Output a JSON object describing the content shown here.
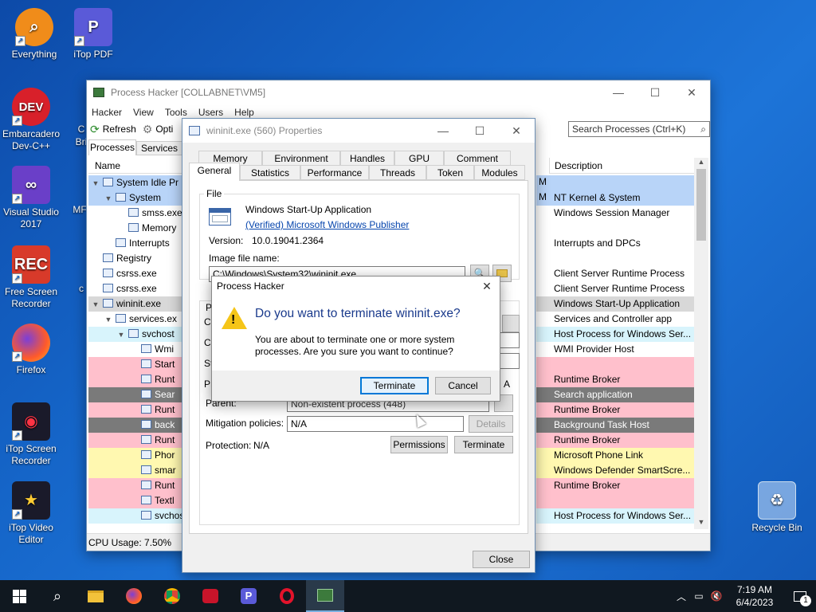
{
  "desktop": {
    "icons": [
      {
        "label": "Everything"
      },
      {
        "label": "iTop PDF"
      },
      {
        "label": "Embarcadero Dev-C++"
      },
      {
        "label": "Visual Studio 2017"
      },
      {
        "label": "Free Screen Recorder"
      },
      {
        "label": "Firefox"
      },
      {
        "label": "iTop Screen Recorder"
      },
      {
        "label": "iTop Video Editor"
      },
      {
        "label": "Recycle Bin"
      }
    ],
    "partial_labels": {
      "c1": "C",
      "c2": "Bri",
      "c3": "MF",
      "c4": "c"
    }
  },
  "main_window": {
    "title": "Process Hacker [COLLABNET\\VM5]",
    "menu": [
      "Hacker",
      "View",
      "Tools",
      "Users",
      "Help"
    ],
    "toolbar": {
      "refresh": "Refresh",
      "options": "Opti"
    },
    "search_placeholder": "Search Processes (Ctrl+K)",
    "tabs": [
      "Processes",
      "Services"
    ],
    "columns": {
      "name": "Name",
      "description": "Description"
    },
    "tree": [
      {
        "name": "System Idle Pr",
        "color": "#b8d4f8"
      },
      {
        "name": "System",
        "color": "#b8d4f8"
      },
      {
        "name": "smss.exe",
        "color": "#ffffff"
      },
      {
        "name": "Memory",
        "color": "#ffffff"
      },
      {
        "name": "Interrupts",
        "color": "#ffffff"
      },
      {
        "name": "Registry",
        "color": "#ffffff"
      },
      {
        "name": "csrss.exe",
        "color": "#ffffff"
      },
      {
        "name": "csrss.exe",
        "color": "#ffffff"
      },
      {
        "name": "wininit.exe",
        "color": "#d8d8d8"
      },
      {
        "name": "services.ex",
        "color": "#ffffff"
      },
      {
        "name": "svchost",
        "color": "#d8f4fc"
      },
      {
        "name": "Wmi",
        "color": "#ffffff"
      },
      {
        "name": "Start",
        "color": "#ffc0cc"
      },
      {
        "name": "Runt",
        "color": "#ffc0cc"
      },
      {
        "name": "Sear",
        "color": "#7a7a7a"
      },
      {
        "name": "Runt",
        "color": "#ffc0cc"
      },
      {
        "name": "back",
        "color": "#7a7a7a"
      },
      {
        "name": "Runt",
        "color": "#ffc0cc"
      },
      {
        "name": "Phor",
        "color": "#fff8b0"
      },
      {
        "name": "smar",
        "color": "#fff8b0"
      },
      {
        "name": "Runt",
        "color": "#ffc0cc"
      },
      {
        "name": "Textl",
        "color": "#ffc0cc"
      },
      {
        "name": "svchost",
        "color": "#d8f4fc"
      }
    ],
    "descriptions": [
      {
        "text": "",
        "color": "#b8d4f8"
      },
      {
        "text": "NT Kernel & System",
        "color": "#b8d4f8"
      },
      {
        "text": "Windows Session Manager",
        "color": "#ffffff"
      },
      {
        "text": "",
        "color": "#ffffff"
      },
      {
        "text": "Interrupts and DPCs",
        "color": "#ffffff"
      },
      {
        "text": "",
        "color": "#ffffff"
      },
      {
        "text": "Client Server Runtime Process",
        "color": "#ffffff"
      },
      {
        "text": "Client Server Runtime Process",
        "color": "#ffffff"
      },
      {
        "text": "Windows Start-Up Application",
        "color": "#d8d8d8"
      },
      {
        "text": "Services and Controller app",
        "color": "#ffffff"
      },
      {
        "text": "Host Process for Windows Ser...",
        "color": "#d8f4fc"
      },
      {
        "text": "WMI Provider Host",
        "color": "#ffffff"
      },
      {
        "text": "",
        "color": "#ffc0cc"
      },
      {
        "text": "Runtime Broker",
        "color": "#ffc0cc"
      },
      {
        "text": "Search application",
        "color": "#7a7a7a"
      },
      {
        "text": "Runtime Broker",
        "color": "#ffc0cc"
      },
      {
        "text": "Background Task Host",
        "color": "#7a7a7a"
      },
      {
        "text": "Runtime Broker",
        "color": "#ffc0cc"
      },
      {
        "text": "Microsoft Phone Link",
        "color": "#fff8b0"
      },
      {
        "text": "Windows Defender SmartScre...",
        "color": "#fff8b0"
      },
      {
        "text": "Runtime Broker",
        "color": "#ffc0cc"
      },
      {
        "text": "",
        "color": "#ffc0cc"
      },
      {
        "text": "Host Process for Windows Ser...",
        "color": "#d8f4fc"
      }
    ],
    "m_marks": [
      "M",
      "M"
    ],
    "cpu_usage": "CPU Usage: 7.50%"
  },
  "props_window": {
    "title": "wininit.exe (560) Properties",
    "tabs_top": [
      "Memory",
      "Environment",
      "Handles",
      "GPU",
      "Comment"
    ],
    "tabs_bottom": [
      "General",
      "Statistics",
      "Performance",
      "Threads",
      "Token",
      "Modules"
    ],
    "file_group": "File",
    "app_name": "Windows Start-Up Application",
    "publisher": "(Verified) Microsoft Windows Publisher",
    "version_label": "Version:",
    "version": "10.0.19041.2364",
    "image_label": "Image file name:",
    "image_path": "C:\\Windows\\System32\\wininit.exe",
    "proc_group_stub": "Pr",
    "stubs": [
      "Co",
      "Cu",
      "St",
      "PE"
    ],
    "stub_right": "A",
    "parent_label": "Parent:",
    "parent_value": "Non-existent process (448)",
    "mitigation_label": "Mitigation policies:",
    "mitigation_value": "N/A",
    "details_btn": "Details",
    "protection_label": "Protection:",
    "protection_value": "N/A",
    "permissions_btn": "Permissions",
    "terminate_btn": "Terminate",
    "close_btn": "Close"
  },
  "dialog": {
    "title": "Process Hacker",
    "heading": "Do you want to terminate wininit.exe?",
    "body": "You are about to terminate one or more system processes. Are you sure you want to continue?",
    "terminate": "Terminate",
    "cancel": "Cancel"
  },
  "taskbar": {
    "time": "7:19 AM",
    "date": "6/4/2023",
    "notification_count": "1"
  },
  "colors": {
    "accent": "#0078d7",
    "link": "#0645ad",
    "heading": "#1a3a8c"
  }
}
